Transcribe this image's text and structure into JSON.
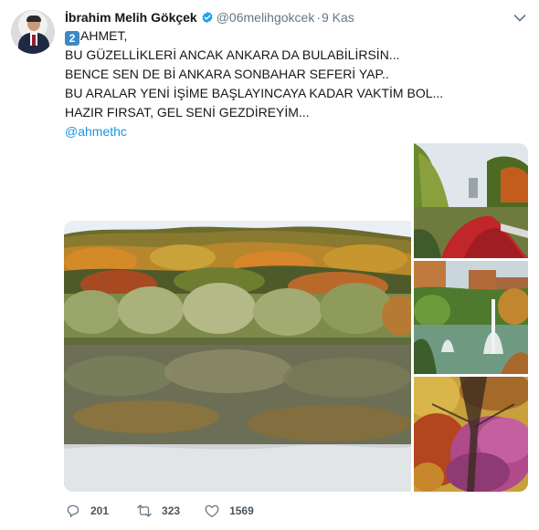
{
  "author": {
    "display_name": "İbrahim Melih Gökçek",
    "handle": "@06melihgokcek",
    "separator": "·",
    "timestamp": "9 Kas",
    "verified": true
  },
  "tweet": {
    "keycap": "2",
    "lines": [
      "AHMET,",
      "BU GÜZELLİKLERİ ANCAK ANKARA DA BULABİLİRSİN...",
      "BENCE SEN DE Bİ ANKARA SONBAHAR SEFERİ YAP..",
      "BU ARALAR YENİ İŞİME BAŞLAYINCAYA KADAR VAKTİM BOL...",
      "HAZIR FIRSAT, GEL SENİ GEZDİREYİM..."
    ],
    "mention": "@ahmethc"
  },
  "media": {
    "images": [
      "autumn-lake-forest",
      "willow-park-red-flowers",
      "park-fountain",
      "purple-autumn-trees"
    ]
  },
  "actions": {
    "replies": "201",
    "retweets": "323",
    "likes": "1569"
  },
  "colors": {
    "link": "#1b95e0",
    "verified": "#1da1f2",
    "muted": "#657786"
  }
}
